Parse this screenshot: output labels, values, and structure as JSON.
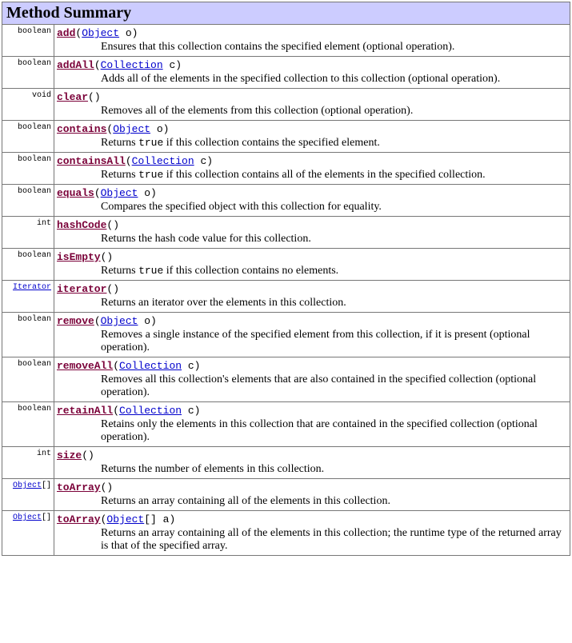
{
  "header": "Method Summary",
  "methods": [
    {
      "return_type": "boolean",
      "return_is_link": false,
      "name": "add",
      "params": [
        {
          "type": "Object",
          "name": "o"
        }
      ],
      "desc_pre": "Ensures that this collection contains the specified element (optional operation).",
      "desc_code": "",
      "desc_post": ""
    },
    {
      "return_type": "boolean",
      "return_is_link": false,
      "name": "addAll",
      "params": [
        {
          "type": "Collection",
          "name": "c"
        }
      ],
      "desc_pre": "Adds all of the elements in the specified collection to this collection (optional operation).",
      "desc_code": "",
      "desc_post": ""
    },
    {
      "return_type": "void",
      "return_is_link": false,
      "name": "clear",
      "params": [],
      "desc_pre": "Removes all of the elements from this collection (optional operation).",
      "desc_code": "",
      "desc_post": ""
    },
    {
      "return_type": "boolean",
      "return_is_link": false,
      "name": "contains",
      "params": [
        {
          "type": "Object",
          "name": "o"
        }
      ],
      "desc_pre": "Returns ",
      "desc_code": "true",
      "desc_post": " if this collection contains the specified element."
    },
    {
      "return_type": "boolean",
      "return_is_link": false,
      "name": "containsAll",
      "params": [
        {
          "type": "Collection",
          "name": "c"
        }
      ],
      "desc_pre": "Returns ",
      "desc_code": "true",
      "desc_post": " if this collection contains all of the elements in the specified collection."
    },
    {
      "return_type": "boolean",
      "return_is_link": false,
      "name": "equals",
      "params": [
        {
          "type": "Object",
          "name": "o"
        }
      ],
      "desc_pre": "Compares the specified object with this collection for equality.",
      "desc_code": "",
      "desc_post": ""
    },
    {
      "return_type": "int",
      "return_is_link": false,
      "name": "hashCode",
      "params": [],
      "desc_pre": "Returns the hash code value for this collection.",
      "desc_code": "",
      "desc_post": ""
    },
    {
      "return_type": "boolean",
      "return_is_link": false,
      "name": "isEmpty",
      "params": [],
      "desc_pre": "Returns ",
      "desc_code": "true",
      "desc_post": " if this collection contains no elements."
    },
    {
      "return_type": "Iterator",
      "return_is_link": true,
      "name": "iterator",
      "params": [],
      "desc_pre": "Returns an iterator over the elements in this collection.",
      "desc_code": "",
      "desc_post": ""
    },
    {
      "return_type": "boolean",
      "return_is_link": false,
      "name": "remove",
      "params": [
        {
          "type": "Object",
          "name": "o"
        }
      ],
      "desc_pre": "Removes a single instance of the specified element from this collection, if it is present (optional operation).",
      "desc_code": "",
      "desc_post": ""
    },
    {
      "return_type": "boolean",
      "return_is_link": false,
      "name": "removeAll",
      "params": [
        {
          "type": "Collection",
          "name": "c"
        }
      ],
      "desc_pre": "Removes all this collection's elements that are also contained in the specified collection (optional operation).",
      "desc_code": "",
      "desc_post": ""
    },
    {
      "return_type": "boolean",
      "return_is_link": false,
      "name": "retainAll",
      "params": [
        {
          "type": "Collection",
          "name": "c"
        }
      ],
      "desc_pre": "Retains only the elements in this collection that are contained in the specified collection (optional operation).",
      "desc_code": "",
      "desc_post": ""
    },
    {
      "return_type": "int",
      "return_is_link": false,
      "name": "size",
      "params": [],
      "desc_pre": "Returns the number of elements in this collection.",
      "desc_code": "",
      "desc_post": ""
    },
    {
      "return_type": "Object[]",
      "return_is_link": true,
      "return_link_text": "Object",
      "return_suffix": "[]",
      "name": "toArray",
      "params": [],
      "desc_pre": "Returns an array containing all of the elements in this collection.",
      "desc_code": "",
      "desc_post": ""
    },
    {
      "return_type": "Object[]",
      "return_is_link": true,
      "return_link_text": "Object",
      "return_suffix": "[]",
      "name": "toArray",
      "params": [
        {
          "type": "Object",
          "suffix": "[]",
          "name": "a"
        }
      ],
      "desc_pre": "Returns an array containing all of the elements in this collection; the runtime type of the returned array is that of the specified array.",
      "desc_code": "",
      "desc_post": ""
    }
  ]
}
